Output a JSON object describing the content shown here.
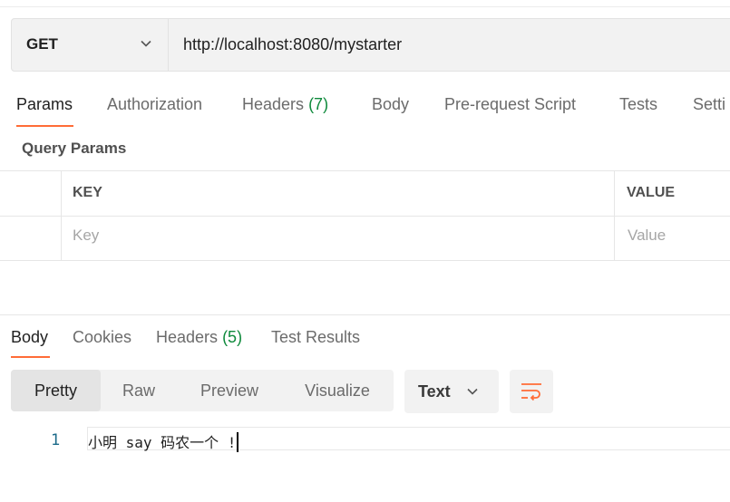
{
  "request": {
    "method": "GET",
    "url": "http://localhost:8080/mystarter"
  },
  "request_tabs": [
    {
      "label": "Params",
      "count": "",
      "active": true
    },
    {
      "label": "Authorization",
      "count": "",
      "active": false
    },
    {
      "label": "Headers",
      "count": "(7)",
      "active": false
    },
    {
      "label": "Body",
      "count": "",
      "active": false
    },
    {
      "label": "Pre-request Script",
      "count": "",
      "active": false
    },
    {
      "label": "Tests",
      "count": "",
      "active": false
    },
    {
      "label": "Setti",
      "count": "",
      "active": false
    }
  ],
  "query_params": {
    "section_label": "Query Params",
    "columns": [
      "KEY",
      "VALUE"
    ],
    "placeholders": {
      "key": "Key",
      "value": "Value"
    }
  },
  "response_tabs": [
    {
      "label": "Body",
      "count": "",
      "active": true
    },
    {
      "label": "Cookies",
      "count": "",
      "active": false
    },
    {
      "label": "Headers",
      "count": "(5)",
      "active": false
    },
    {
      "label": "Test Results",
      "count": "",
      "active": false
    }
  ],
  "view_modes": [
    "Pretty",
    "Raw",
    "Preview",
    "Visualize"
  ],
  "active_view_mode": "Pretty",
  "format_select": {
    "selected": "Text"
  },
  "response_body": {
    "line_number": "1",
    "text": "小明 say 码农一个 !"
  },
  "colors": {
    "accent": "#ff6c37",
    "count_green": "#0f8a3c"
  },
  "icons": {
    "method_dropdown": "chevron-down-icon",
    "format_dropdown": "chevron-down-icon",
    "wrap": "wrap-lines-icon"
  }
}
